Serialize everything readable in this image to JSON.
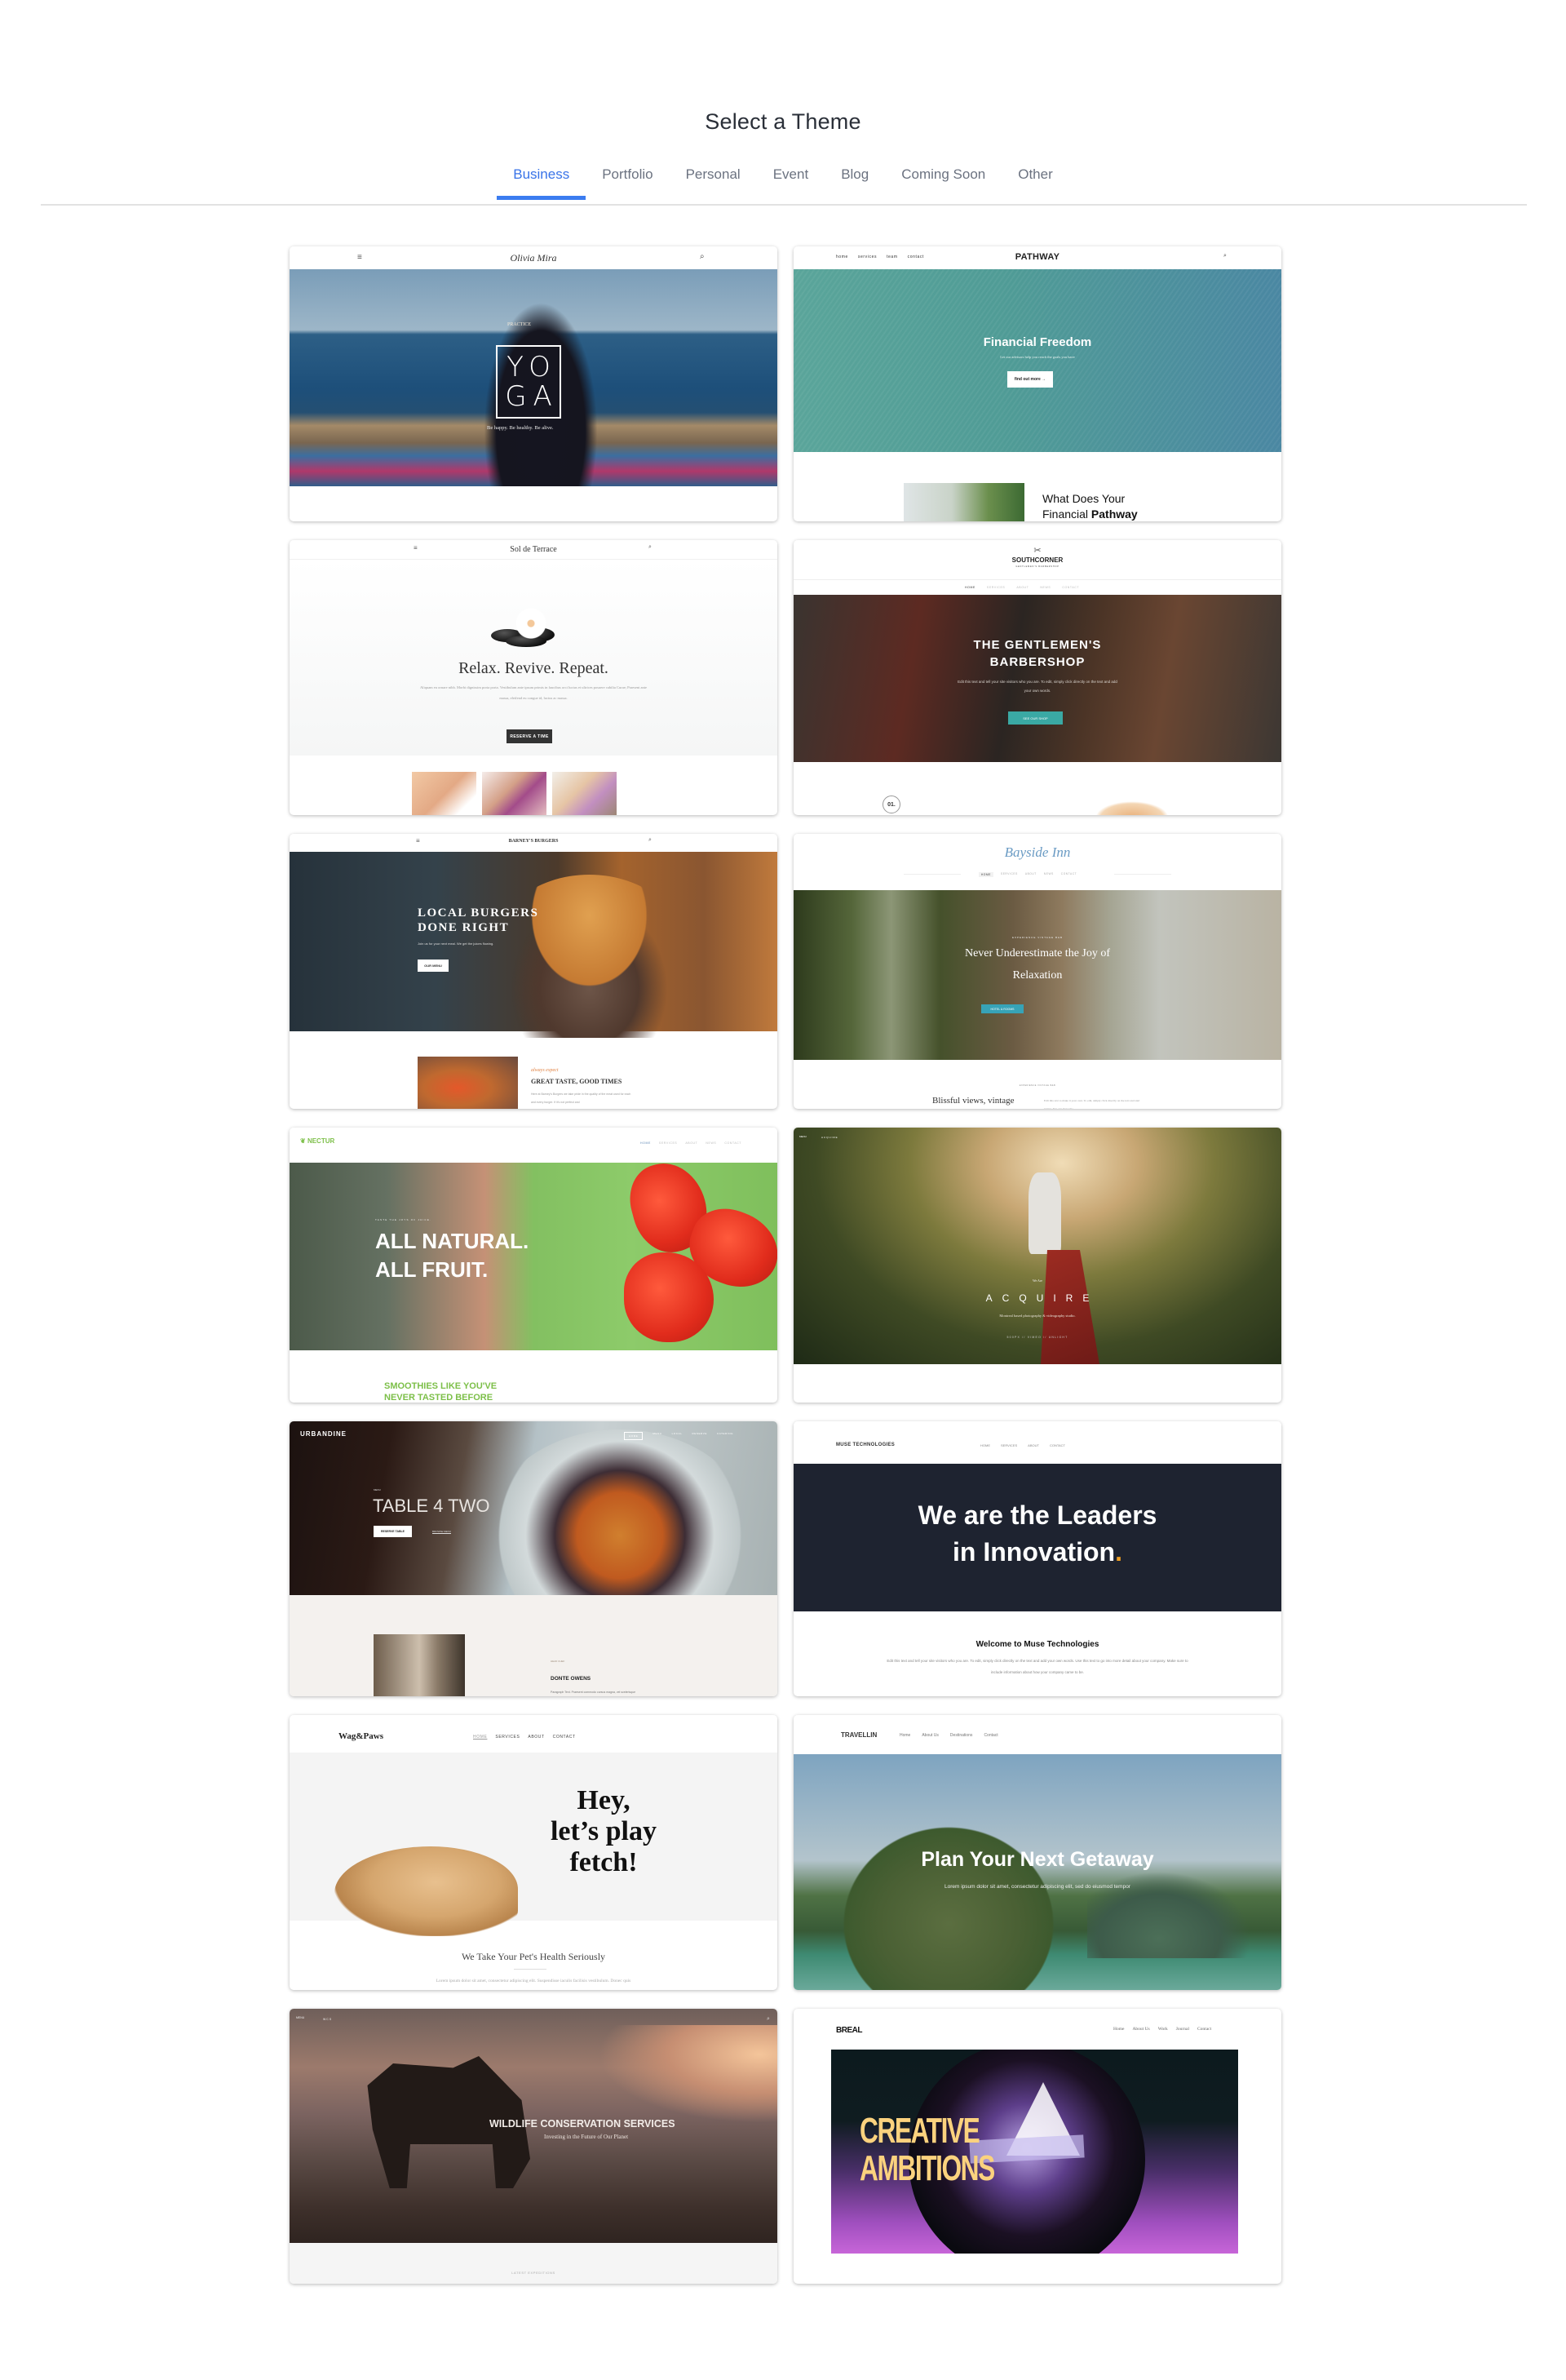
{
  "header": {
    "title": "Select a Theme"
  },
  "tabs": [
    {
      "label": "Business",
      "active": true
    },
    {
      "label": "Portfolio",
      "active": false
    },
    {
      "label": "Personal",
      "active": false
    },
    {
      "label": "Event",
      "active": false
    },
    {
      "label": "Blog",
      "active": false
    },
    {
      "label": "Coming Soon",
      "active": false
    },
    {
      "label": "Other",
      "active": false
    }
  ],
  "colors": {
    "accent": "#3b7cf0",
    "tab_inactive": "#6b7280",
    "title": "#2a2f38"
  },
  "themes": [
    {
      "name": "Olivia Mira",
      "logo": "Olivia Mira",
      "kicker": "PRACTICE",
      "hero_line1": "YO",
      "hero_line2": "GA",
      "tagline": "Be happy. Be healthy. Be alive."
    },
    {
      "name": "Pathway",
      "logo": "PATHWAY",
      "nav": [
        "home",
        "services",
        "team",
        "contact"
      ],
      "headline": "Financial Freedom",
      "subtext": "Let our advisors help you reach the goals you have",
      "button": "find out more →",
      "section_title": "What Does Your",
      "section_title2": "Financial ",
      "section_title2_bold": "Pathway"
    },
    {
      "name": "Sol de Terrace",
      "logo": "Sol de Terrace",
      "headline": "Relax. Revive. Repeat.",
      "body": "Aliquam eu ornare nibh. Morbi dignissim porta porta. Vestibulum ante ipsum primis in faucibus orci luctus et ultrices posuere cubilia Curae; Praesent ante massa, eleifend eu congue id, luctus ac massa.",
      "button": "RESERVE A TIME"
    },
    {
      "name": "Southcorner",
      "logo": "SOUTHCORNER",
      "logo_sub": "GENTLEMEN'S BARBERSHOP",
      "nav": [
        "HOME",
        "SERVICES",
        "ABOUT",
        "NEWS",
        "CONTACT"
      ],
      "headline1": "THE GENTLEMEN'S",
      "headline2": "BARBERSHOP",
      "body": "Edit this text and tell your site visitors who you are. To edit, simply click directly on the text and add your own words.",
      "button": "SEE OUR SHOP",
      "badge": "01."
    },
    {
      "name": "Barney's Burgers",
      "logo": "BARNEY'S BURGERS",
      "headline1": "LOCAL BURGERS",
      "headline2": "DONE RIGHT",
      "subtext": "Join us for your next meal. We get the juices flowing.",
      "button": "OUR MENU",
      "kicker": "always expect",
      "section_title": "GREAT TASTE, GOOD TIMES",
      "body": "Here at Barney's Burgers we take pride in the quality of the meat used for each and every burger. If it's not perfect and"
    },
    {
      "name": "Bayside Inn",
      "logo": "Bayside Inn",
      "nav": [
        "HOME",
        "SERVICES",
        "ABOUT",
        "NEWS",
        "CONTACT"
      ],
      "kicker": "EXPERIENCE VINTAGE B&B",
      "headline1": "Never Underestimate the Joy of",
      "headline2": "Relaxation",
      "button": "HOTEL & ROOMS",
      "section_kicker": "EXPERIENCE VINTAGE B&B",
      "section_title": "Blissful views, vintage",
      "body": "Edit this text to make it your own. To edit, simply click directly on the text and start typing. You can move the"
    },
    {
      "name": "Nectur",
      "logo": "NECTUR",
      "nav": [
        "HOME",
        "SERVICES",
        "ABOUT",
        "NEWS",
        "CONTACT"
      ],
      "kicker": "TASTE THE JOYS OF JUICE.",
      "headline1": "ALL NATURAL.",
      "headline2": "ALL FRUIT.",
      "section_title1": "SMOOTHIES LIKE YOU'VE",
      "section_title2": "NEVER TASTED BEFORE"
    },
    {
      "name": "Acquire",
      "menu": "MENU",
      "logo": "ACQUIRE",
      "kicker": "We Are",
      "headline": "ACQUIRE",
      "subtext": "Montreal based photography & videography studio.",
      "links": "500PX  //  VIMEO  //  UNLIGHT"
    },
    {
      "name": "Urbandine",
      "logo": "URBANDINE",
      "nav": [
        "HOME",
        "MENU",
        "LOCAL",
        "RESERVE",
        "CATERING"
      ],
      "kicker": "MENU",
      "headline": "TABLE 4 TWO",
      "button": "RESERVE TABLE",
      "link": "BROWSE MENU",
      "section_kicker": "HEAD CHEF",
      "section_title": "DONTE OWENS",
      "body": "Paragraph Text. Praesent commodo cursus magna, vel scelerisque"
    },
    {
      "name": "Muse Technologies",
      "logo": "MUSE TECHNOLOGIES",
      "nav": [
        "HOME",
        "SERVICES",
        "ABOUT",
        "CONTACT"
      ],
      "headline1": "We are the Leaders",
      "headline2": "in Innovation",
      "headline_dot": ".",
      "section_title": "Welcome to Muse Technologies",
      "body": "Edit this text and tell your site visitors who you are. To edit, simply click directly on the text and add your own words. Use this text to go into more detail about your company. Make sure to include information about how your company came to be."
    },
    {
      "name": "Wag&Paws",
      "logo": "Wag&Paws",
      "nav": [
        "HOME",
        "SERVICES",
        "ABOUT",
        "CONTACT"
      ],
      "headline1": "Hey,",
      "headline2": "let’s play",
      "headline3": "fetch!",
      "section_title": "We Take Your Pet's Health Seriously",
      "body": "Lorem ipsum dolor sit amet, consectetur adipiscing elit. Suspendisse iaculis facilisis vestibulum. Donec quis"
    },
    {
      "name": "Travellin",
      "logo": "TRAVELLIN",
      "nav": [
        "Home",
        "About Us",
        "Destinations",
        "Contact"
      ],
      "headline": "Plan Your Next Getaway",
      "subtext": "Lorem ipsum dolor sit amet, consectetur adipiscing elit, sed do eiusmod tempor"
    },
    {
      "name": "Wildlife Conservation Services",
      "menu": "MENU",
      "logo": "WCS",
      "headline": "WILDLIFE CONSERVATION SERVICES",
      "subtext": "Investing in the Future of Our Planet",
      "section_kicker": "LATEST EXPEDITIONS"
    },
    {
      "name": "Breal",
      "logo": "BREAL",
      "nav": [
        "Home",
        "About Us",
        "Work",
        "Journal",
        "Contact"
      ],
      "headline1": "CREATIVE",
      "headline2": "AMBITIONS"
    }
  ]
}
